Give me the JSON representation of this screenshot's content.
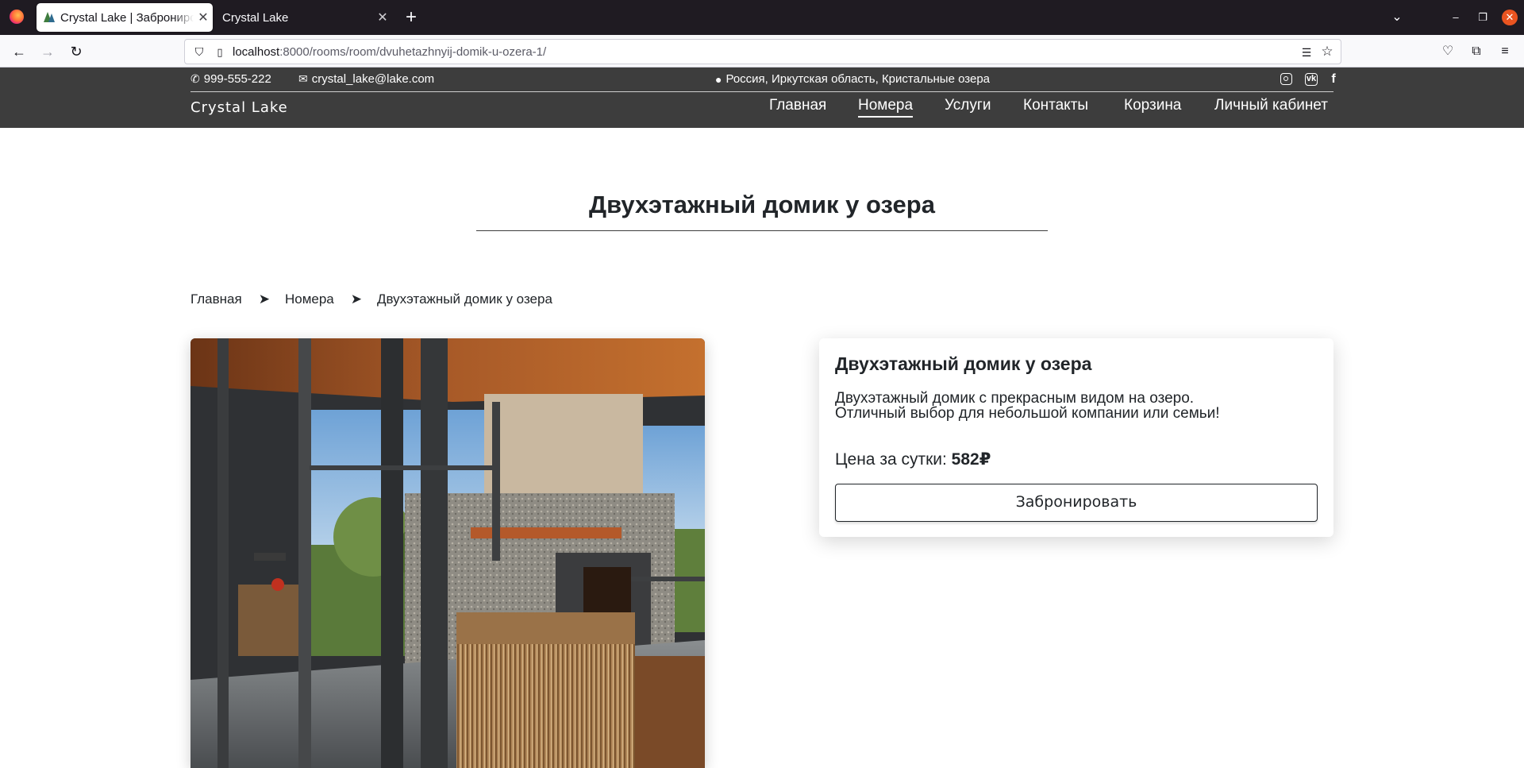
{
  "browser": {
    "tabs": [
      {
        "title": "Crystal Lake | Забронировать",
        "active": true
      },
      {
        "title": "Crystal Lake",
        "active": false
      }
    ],
    "url_host": "localhost",
    "url_rest": ":8000/rooms/room/dvuhetazhnyij-domik-u-ozera-1/"
  },
  "header": {
    "phone": "999-555-222",
    "email": "crystal_lake@lake.com",
    "address": "Россия, Иркутская область, Кристальные озера",
    "brand": "Crystal Lake",
    "menu": [
      "Главная",
      "Номера",
      "Услуги",
      "Контакты",
      "Корзина",
      "Личный кабинет"
    ],
    "active_menu": "Номера",
    "social": [
      "instagram-icon",
      "vk-icon",
      "facebook-icon"
    ]
  },
  "page": {
    "title": "Двухэтажный домик у озера",
    "breadcrumb": [
      "Главная",
      "Номера",
      "Двухэтажный домик у озера"
    ],
    "breadcrumb_sep": "➤"
  },
  "card": {
    "title": "Двухэтажный домик у озера",
    "description_line1": "Двухэтажный домик с прекрасным видом на озеро.",
    "description_line2": "Отличный выбор для небольшой компании или семьи!",
    "price_label": "Цена за сутки: ",
    "price_value": "582₽",
    "book_label": "Забронировать"
  },
  "colors": {
    "header_bg": "#3d3d3d",
    "text": "#212529",
    "tabbar_bg": "#1f1b22"
  }
}
